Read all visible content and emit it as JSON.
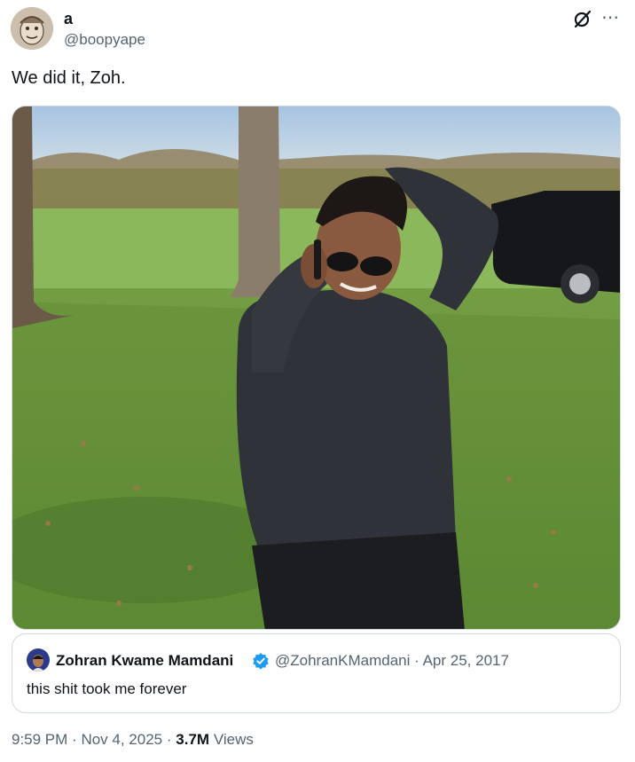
{
  "author": {
    "display_name": "a",
    "handle": "@boopyape"
  },
  "tweet": {
    "text": "We did it, Zoh."
  },
  "header_icons": {
    "grok": "grok-icon",
    "more": "more-icon"
  },
  "quote": {
    "display_name": "Zohran Kwame Mamdani",
    "verified": true,
    "handle": "@ZohranKMamdani",
    "separator": "·",
    "date": "Apr 25, 2017",
    "text": "this shit took me forever"
  },
  "footer": {
    "time": "9:59 PM",
    "sep1": "·",
    "date": "Nov 4, 2025",
    "sep2": "·",
    "views_count": "3.7M",
    "views_label": "Views"
  },
  "colors": {
    "text_primary": "#0f1419",
    "text_secondary": "#536471",
    "border": "#cfd9de",
    "verified_blue": "#1d9bf0"
  }
}
